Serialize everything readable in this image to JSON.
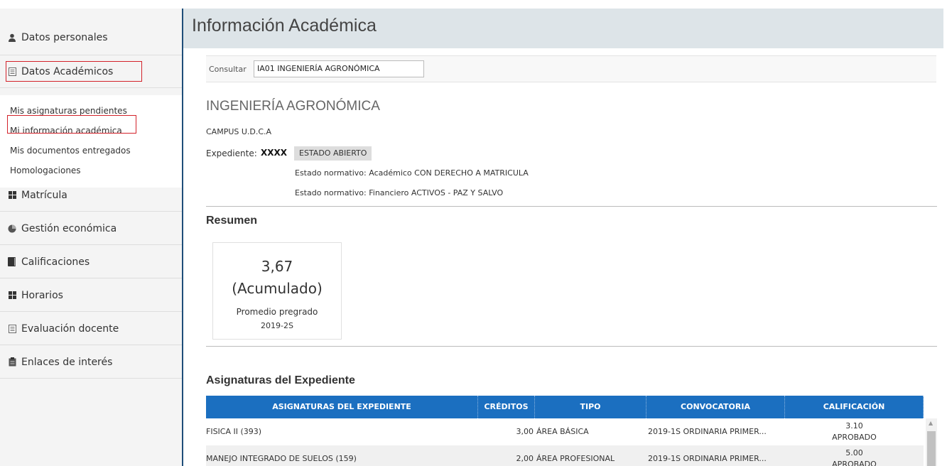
{
  "sidebar": {
    "personal": "Datos personales",
    "academic": "Datos Académicos",
    "sub_items": [
      "Mis asignaturas pendientes",
      "Mi información académica",
      "Mis documentos entregados",
      "Homologaciones"
    ],
    "items": [
      "Matrícula",
      "Gestión económica",
      "Calificaciones",
      "Horarios",
      "Evaluación docente",
      "Enlaces de interés"
    ],
    "icons": [
      "person-icon",
      "list-icon",
      "grid-icon",
      "pie-icon",
      "book-icon",
      "grid-icon",
      "list-icon",
      "clipboard-icon"
    ]
  },
  "header": {
    "title": "Información Académica"
  },
  "consult": {
    "label": "Consultar",
    "value": "IA01 INGENIERÍA AGRONÓMICA"
  },
  "program": {
    "name": "INGENIERÍA AGRONÓMICA",
    "campus": "CAMPUS U.D.C.A",
    "expediente_label": "Expediente:",
    "expediente_value": "XXXX",
    "estado": "ESTADO ABIERTO",
    "normativo_1": "Estado normativo: Académico CON DERECHO A MATRICULA",
    "normativo_2": "Estado normativo: Financiero ACTIVOS - PAZ Y SALVO"
  },
  "resumen": {
    "title": "Resumen",
    "value": "3,67",
    "type": "(Acumulado)",
    "label": "Promedio pregrado",
    "period": "2019-2S"
  },
  "subjects": {
    "title": "Asignaturas del Expediente",
    "columns": [
      "ASIGNATURAS DEL EXPEDIENTE",
      "CRÉDITOS",
      "TIPO",
      "CONVOCATORIA",
      "CALIFICACIÓN"
    ],
    "rows": [
      {
        "name": "FISICA II (393)",
        "credits": "3,00",
        "type": "ÁREA BÁSICA",
        "convocatoria": "2019-1S ORDINARIA PRIMER...",
        "grade": "3.10",
        "status": "APROBADO"
      },
      {
        "name": "MANEJO INTEGRADO DE SUELOS (159)",
        "credits": "2,00",
        "type": "ÁREA PROFESIONAL",
        "convocatoria": "2019-1S ORDINARIA PRIMER...",
        "grade": "5.00",
        "status": "APROBADO"
      }
    ]
  },
  "colors": {
    "accent": "#1b6fc0",
    "sidebar_rule": "#1f4e79",
    "highlight": "#d3222a"
  }
}
